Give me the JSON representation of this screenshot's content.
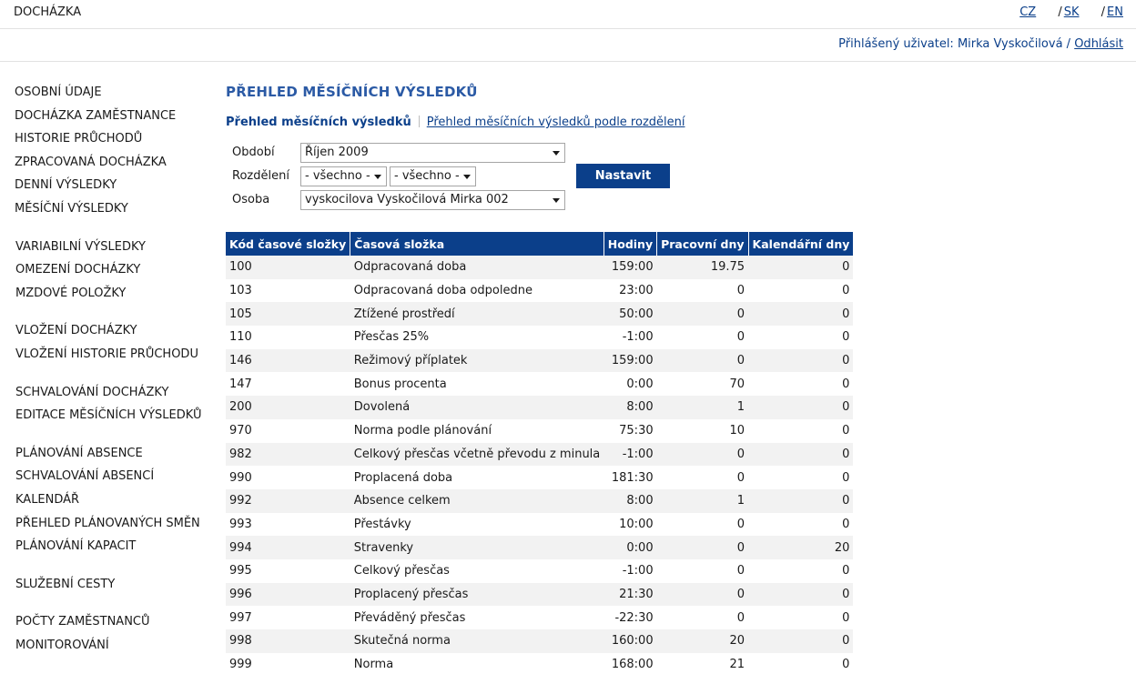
{
  "header": {
    "app_title": "DOCHÁZKA",
    "languages": [
      "CZ",
      "SK",
      "EN"
    ],
    "lang_sep": "/"
  },
  "userbar": {
    "logged_label": "Přihlášený uživatel: Mirka Vyskočilová",
    "sep": "/",
    "logout": "Odhlásit"
  },
  "sidebar": {
    "groups": [
      [
        "Osobní údaje",
        "Docházka zaměstnance",
        "Historie průchodů",
        "Zpracovaná docházka",
        "Denní výsledky",
        "Měsíční výsledky"
      ],
      [
        "Variabilní výsledky",
        "Omezení docházky",
        "Mzdové položky"
      ],
      [
        "Vložení docházky",
        "Vložení historie průchodu"
      ],
      [
        "Schvalování docházky",
        "Editace měsíčních výsledků"
      ],
      [
        "Plánování absence",
        "Schvalování absencí",
        "Kalendář",
        "Přehled plánovaných směn",
        "Plánování kapacit"
      ],
      [
        "Služební cesty"
      ],
      [
        "Počty zaměstnanců",
        "Monitorování"
      ]
    ]
  },
  "main": {
    "title": "PŘEHLED MĚSÍČNÍCH VÝSLEDKŮ",
    "subnav": {
      "active": "Přehled měsíčních výsledků",
      "link": "Přehled měsíčních výsledků podle rozdělení"
    },
    "filters": {
      "period_label": "Období",
      "period_value": "Říjen 2009",
      "division_label": "Rozdělení",
      "division_value_1": "- všechno -",
      "division_value_2": "- všechno -",
      "person_label": "Osoba",
      "person_value": "vyskocilova Vyskočilová Mirka 002",
      "submit": "Nastavit"
    },
    "table": {
      "headers": [
        "Kód časové složky",
        "Časová složka",
        "Hodiny",
        "Pracovní dny",
        "Kalendářní dny"
      ],
      "rows": [
        [
          "100",
          "Odpracovaná doba",
          "159:00",
          "19.75",
          "0"
        ],
        [
          "103",
          "Odpracovaná doba odpoledne",
          "23:00",
          "0",
          "0"
        ],
        [
          "105",
          "Ztížené prostředí",
          "50:00",
          "0",
          "0"
        ],
        [
          "110",
          "Přesčas 25%",
          "-1:00",
          "0",
          "0"
        ],
        [
          "146",
          "Režimový příplatek",
          "159:00",
          "0",
          "0"
        ],
        [
          "147",
          "Bonus procenta",
          "0:00",
          "70",
          "0"
        ],
        [
          "200",
          "Dovolená",
          "8:00",
          "1",
          "0"
        ],
        [
          "970",
          "Norma podle plánování",
          "75:30",
          "10",
          "0"
        ],
        [
          "982",
          "Celkový přesčas včetně převodu z minula",
          "-1:00",
          "0",
          "0"
        ],
        [
          "990",
          "Proplacená doba",
          "181:30",
          "0",
          "0"
        ],
        [
          "992",
          "Absence celkem",
          "8:00",
          "1",
          "0"
        ],
        [
          "993",
          "Přestávky",
          "10:00",
          "0",
          "0"
        ],
        [
          "994",
          "Stravenky",
          "0:00",
          "0",
          "20"
        ],
        [
          "995",
          "Celkový přesčas",
          "-1:00",
          "0",
          "0"
        ],
        [
          "996",
          "Proplacený přesčas",
          "21:30",
          "0",
          "0"
        ],
        [
          "997",
          "Převáděný přesčas",
          "-22:30",
          "0",
          "0"
        ],
        [
          "998",
          "Skutečná norma",
          "160:00",
          "20",
          "0"
        ],
        [
          "999",
          "Norma",
          "168:00",
          "21",
          "0"
        ]
      ]
    }
  }
}
